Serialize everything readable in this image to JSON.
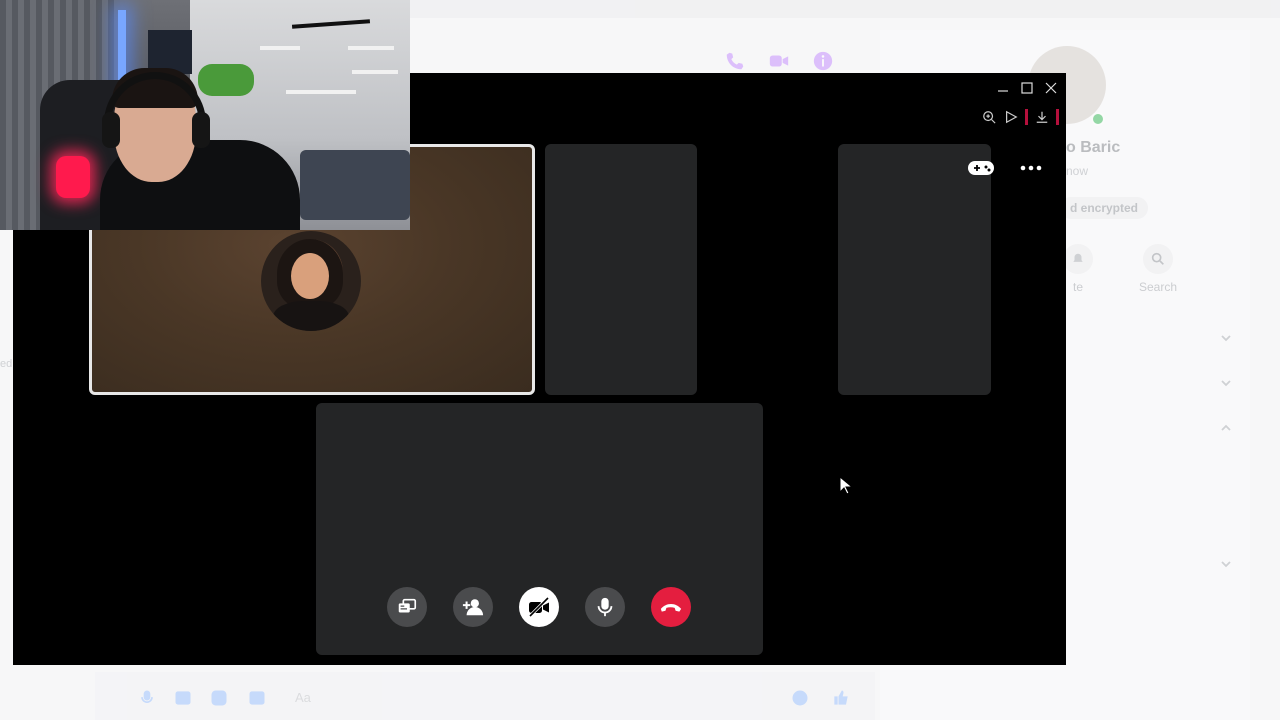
{
  "background": {
    "contact_name": "o Baric",
    "contact_status": "now",
    "encryption_badge": "d encrypted",
    "actions": [
      {
        "label": "te",
        "icon": "bell-icon"
      },
      {
        "label": "Search",
        "icon": "search-icon"
      }
    ],
    "left_fragment": "ed",
    "composer_placeholder": "Aa"
  },
  "call": {
    "participants": [
      {
        "id": "main",
        "has_avatar": true
      },
      {
        "id": "p2",
        "has_avatar": false
      },
      {
        "id": "p3",
        "has_avatar": false
      },
      {
        "id": "p4",
        "has_avatar": false
      }
    ],
    "controls": [
      {
        "name": "share-screen-button",
        "icon": "share-screen-icon"
      },
      {
        "name": "add-person-button",
        "icon": "add-person-icon"
      },
      {
        "name": "camera-off-button",
        "icon": "camera-off-icon"
      },
      {
        "name": "microphone-button",
        "icon": "microphone-icon"
      },
      {
        "name": "end-call-button",
        "icon": "end-call-icon"
      }
    ],
    "colors": {
      "end_call": "#e41e3f",
      "tile": "#242526",
      "accent_bar": "#b5103c"
    }
  },
  "colors": {
    "messenger_accent": "#a033ff",
    "online_dot": "#45bd62"
  }
}
